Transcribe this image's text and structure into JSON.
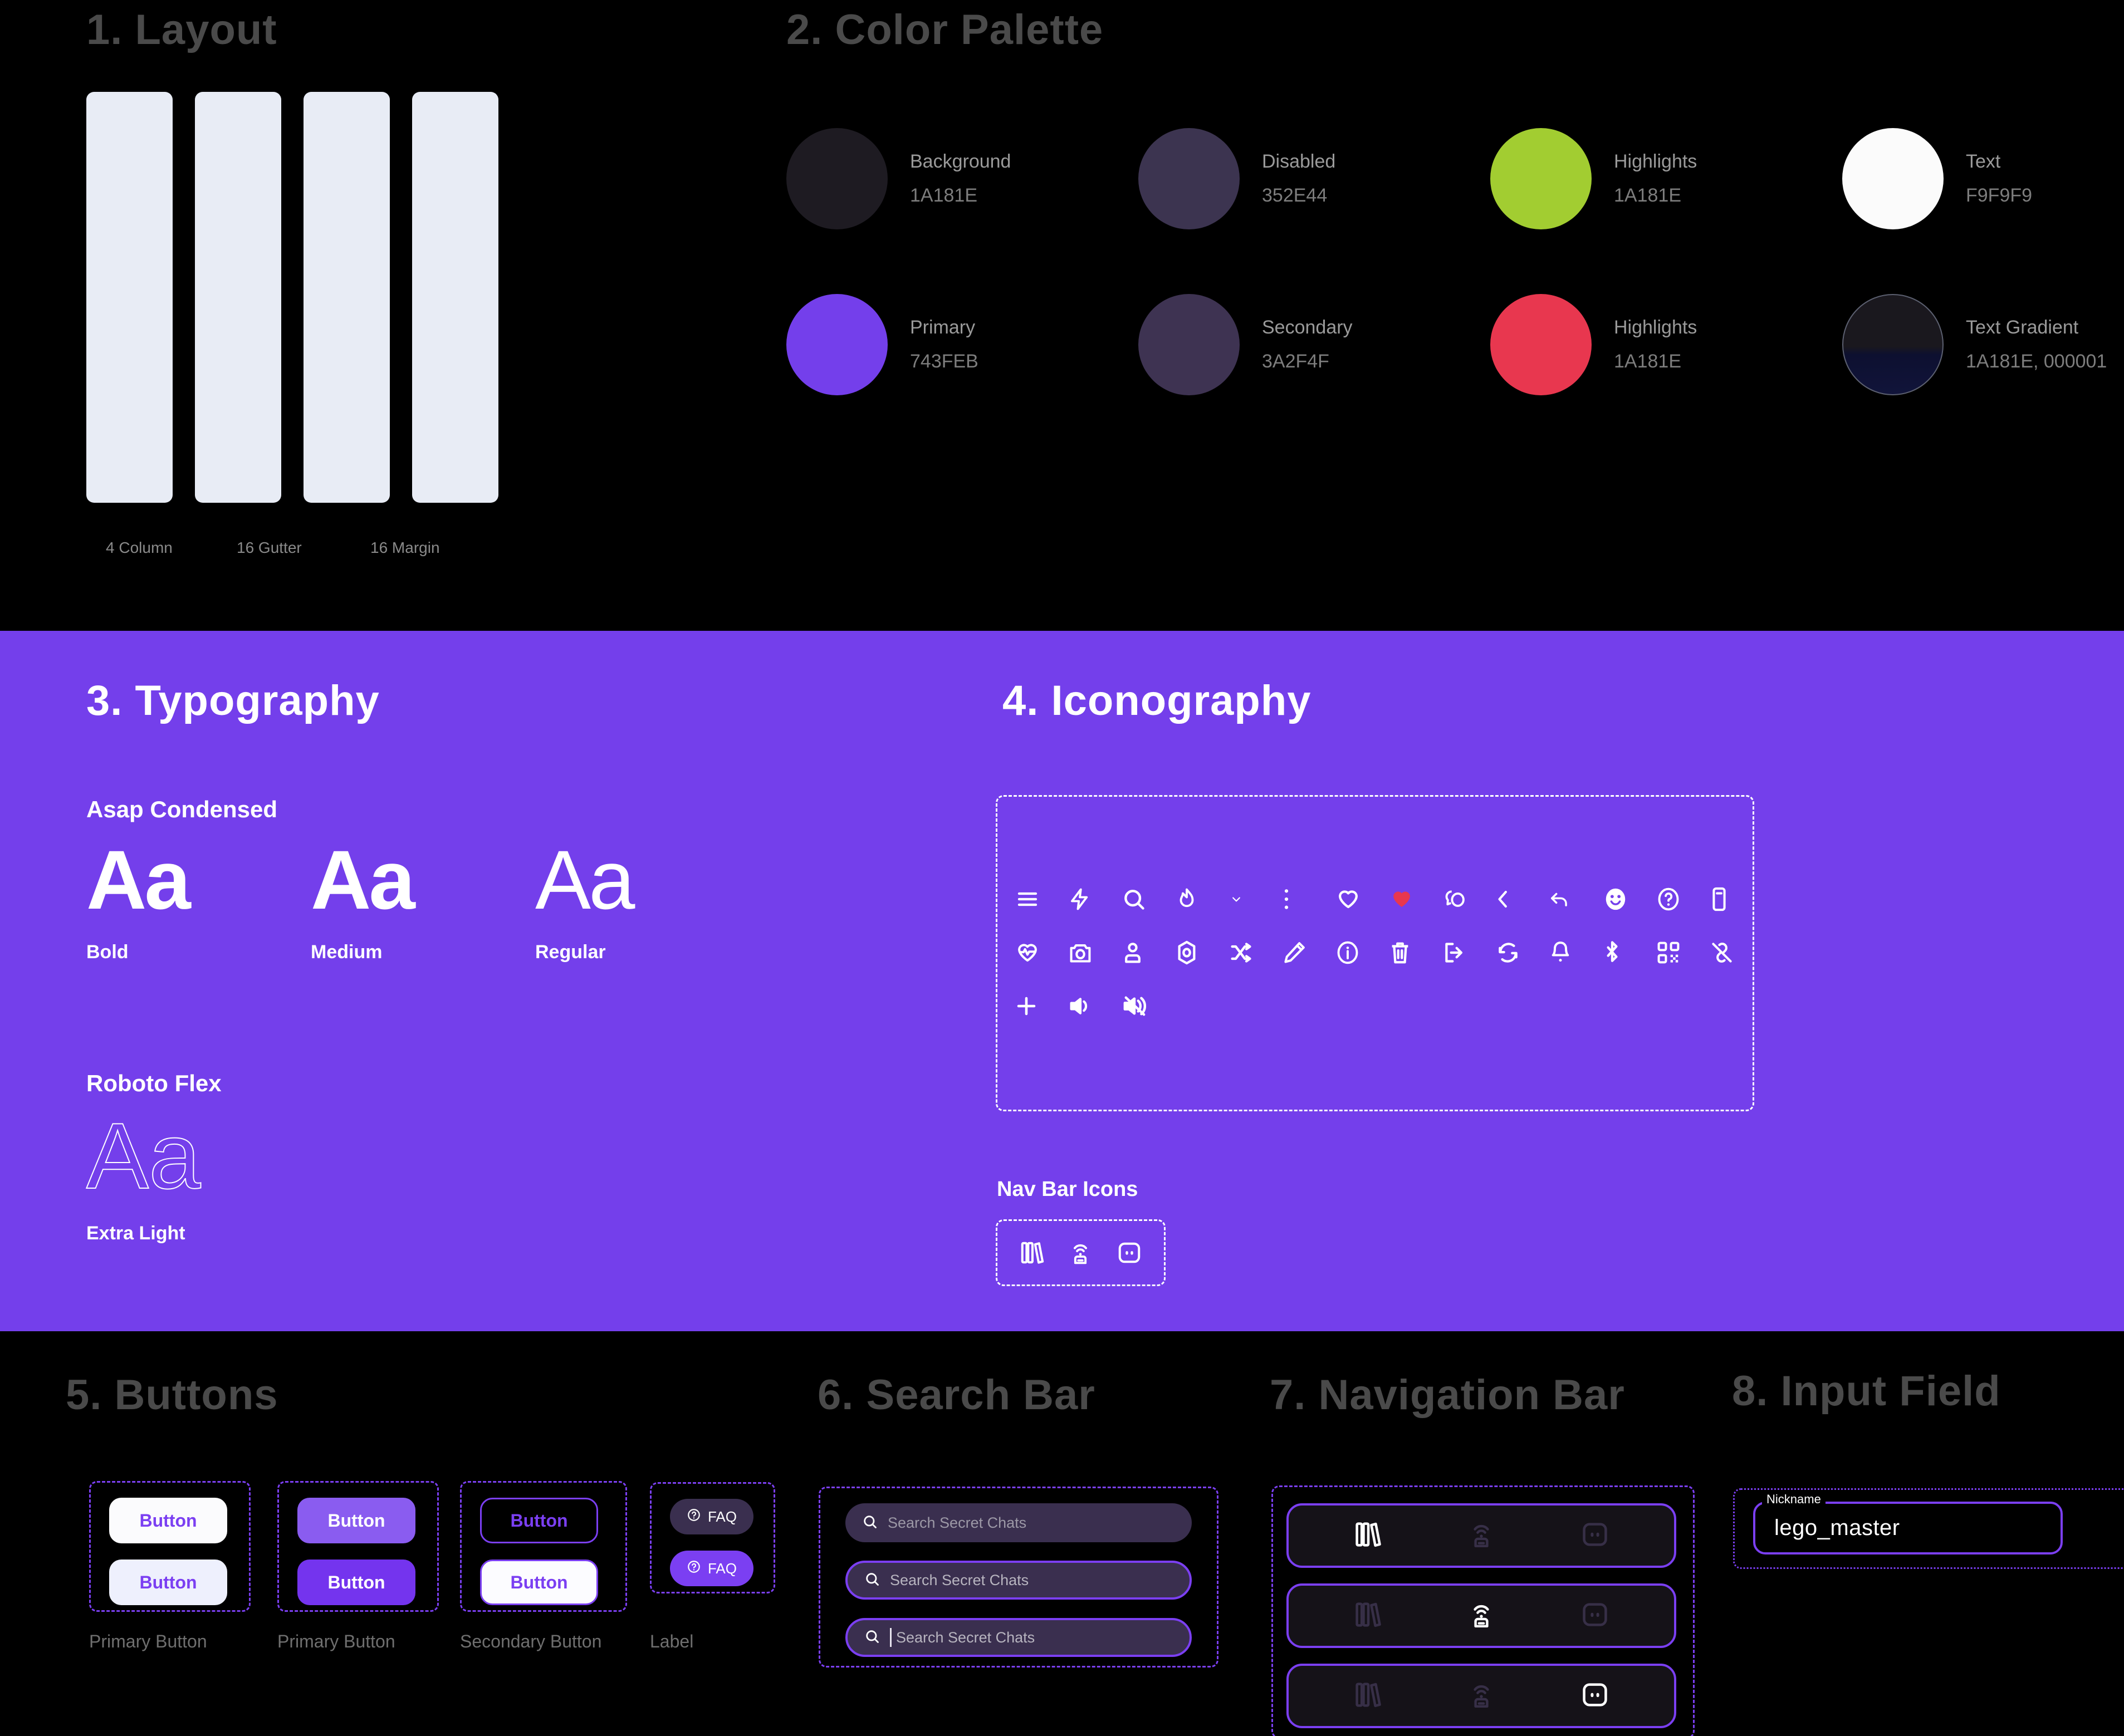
{
  "sections": {
    "layout": {
      "title": "1. Layout",
      "column_labels": [
        "4 Column",
        "16 Gutter",
        "16 Margin"
      ],
      "column_count": 4
    },
    "palette": {
      "title": "2. Color Palette",
      "swatches": [
        {
          "name": "Background",
          "hex": "1A181E",
          "css": "#1E1B22"
        },
        {
          "name": "Disabled",
          "hex": "352E44",
          "css": "#3C3450"
        },
        {
          "name": "Highlights",
          "hex": "1A181E",
          "css": "#A2CD31"
        },
        {
          "name": "Text",
          "hex": "F9F9F9",
          "css": "#FBFBFB"
        },
        {
          "name": "Primary",
          "hex": "743FEB",
          "css": "#743FEB"
        },
        {
          "name": "Secondary",
          "hex": "3A2F4F",
          "css": "#3E3352"
        },
        {
          "name": "Highlights",
          "hex": "1A181E",
          "css": "#E8374F"
        },
        {
          "name": "Text Gradient",
          "hex": "1A181E, 000001",
          "css": "gradient"
        }
      ]
    },
    "typography": {
      "title": "3. Typography",
      "families": [
        {
          "name": "Asap Condensed",
          "samples": [
            {
              "glyph": "Aa",
              "weight_label": "Bold"
            },
            {
              "glyph": "Aa",
              "weight_label": "Medium"
            },
            {
              "glyph": "Aa",
              "weight_label": "Regular"
            }
          ]
        },
        {
          "name": "Roboto Flex",
          "samples": [
            {
              "glyph": "Aa",
              "weight_label": "Extra Light"
            }
          ]
        }
      ]
    },
    "iconography": {
      "title": "4. Iconography",
      "nav_bar_label": "Nav Bar Icons",
      "icon_rows": [
        [
          "menu-icon",
          "lightning-icon",
          "search-icon",
          "flame-icon",
          "chevron-down-icon",
          "more-vertical-icon",
          "heart-outline-icon",
          "heart-filled-icon",
          "chat-bubble-icon",
          "chevron-left-icon",
          "reply-arrow-icon",
          "smiley-icon",
          "question-circle-icon",
          "phone-device-icon"
        ],
        [
          "heartbeat-icon",
          "camera-icon",
          "user-icon",
          "gear-icon",
          "shuffle-icon",
          "pencil-icon",
          "info-circle-icon",
          "trash-icon",
          "logout-icon",
          "refresh-icon",
          "bell-icon",
          "bluetooth-icon",
          "qr-code-icon",
          "link-off-icon"
        ],
        [
          "plus-icon",
          "volume-on-icon",
          "volume-off-icon"
        ]
      ],
      "nav_bar_icons": [
        "library-icon",
        "broadcast-icon",
        "chat-face-icon"
      ],
      "accent_heart_color": "#E8374F"
    },
    "buttons": {
      "title": "5. Buttons",
      "groups": [
        {
          "caption": "Primary Button",
          "items": [
            {
              "label": "Button",
              "style": "white"
            },
            {
              "label": "Button",
              "style": "white2"
            }
          ]
        },
        {
          "caption": "Primary Button",
          "items": [
            {
              "label": "Button",
              "style": "purple"
            },
            {
              "label": "Button",
              "style": "purple2"
            }
          ]
        },
        {
          "caption": "Secondary Button",
          "items": [
            {
              "label": "Button",
              "style": "outline"
            },
            {
              "label": "Button",
              "style": "solidwhite"
            }
          ]
        },
        {
          "caption": "Label",
          "items": [
            {
              "label": "FAQ",
              "style": "pill-dark"
            },
            {
              "label": "FAQ",
              "style": "pill-purple"
            }
          ]
        }
      ]
    },
    "search": {
      "title": "6. Search Bar",
      "bars": [
        {
          "placeholder": "Search Secret Chats",
          "state": "default"
        },
        {
          "placeholder": "Search Secret Chats",
          "state": "focused"
        },
        {
          "placeholder": "Search Secret Chats",
          "state": "typing"
        }
      ]
    },
    "navigation": {
      "title": "7. Navigation Bar",
      "items": [
        "library-icon",
        "broadcast-icon",
        "chat-face-icon"
      ],
      "bars": [
        {
          "active_index": 0
        },
        {
          "active_index": 1
        },
        {
          "active_index": 2
        }
      ]
    },
    "input": {
      "title": "8. Input Field",
      "legend": "Nickname",
      "value": "lego_master"
    }
  }
}
